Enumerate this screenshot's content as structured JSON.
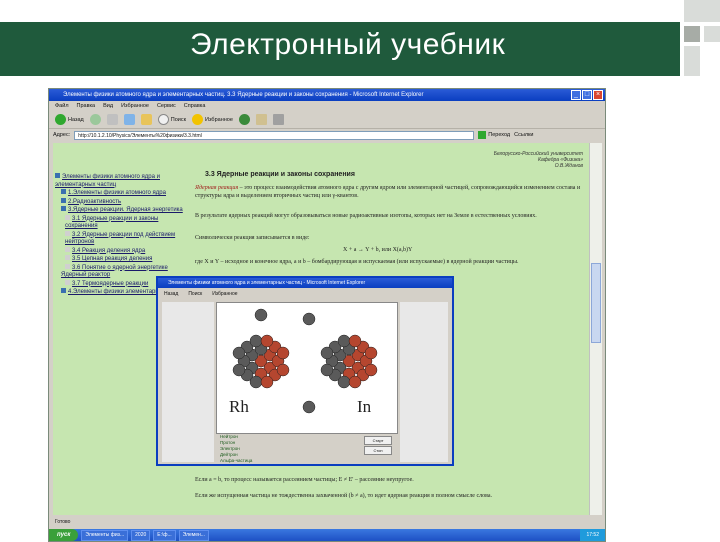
{
  "slide": {
    "title": "Электронный учебник",
    "colors": {
      "title_bg": "#1f5a3c",
      "title_text": "#ffffff",
      "corner_blocks": "#d9dcd9"
    }
  },
  "browser": {
    "window_title": "Элементы физики атомного ядра и элементарных частиц. 3.3 Ядерные реакции и законы сохранения - Microsoft Internet Explorer",
    "menu": [
      "Файл",
      "Правка",
      "Вид",
      "Избранное",
      "Сервис",
      "Справка"
    ],
    "toolbar": {
      "back": "Назад",
      "search": "Поиск",
      "favorites": "Избранное"
    },
    "address_label": "Адрес:",
    "address_value": "http://10.1.2.10/Physics/Элементы%20физики/3.3.html",
    "go_label": "Переход",
    "links_label": "Ссылки",
    "status_text": "Готово",
    "taskbar": {
      "start": "пуск",
      "items": [
        "Элементы физ...",
        "2020",
        "Е:\\ф...",
        "Элемен..."
      ],
      "clock": "17:52"
    }
  },
  "page": {
    "university": [
      "Белорусско-Российский университет",
      "Кафедра «Физика»",
      "О.В.Жданов"
    ],
    "section_title": "3.3 Ядерные реакции и законы сохранения",
    "paragraph1_term": "Ядерная реакция",
    "paragraph1": " – это процесс взаимодействия атомного ядра с другим ядром или элементарной частицей, сопровождающийся изменением состава и структуры ядра и выделением вторичных частиц или γ-квантов.",
    "paragraph2": "В результате ядерных реакций могут образовываться новые радиоактивные изотопы, которых нет на Земле в естественных условиях.",
    "paragraph3": "Символически реакция записывается в виде:",
    "formula": "X + a → Y + b, или X(a,b)Y",
    "paragraph4": "где X и Y – исходное и конечное ядра, a и b – бомбардирующая и испускаемая (или испускаемые) в ядерной реакции частицы.",
    "paragraph5": "Если a = b, то процесс называется рассеянием частицы; Е ≠ E' – рассеяние неупругое.",
    "paragraph6": "Если же испущенная частица не тождественна захваченной (b ≠ a), то идет ядерная реакция в полном смысле слова."
  },
  "nav": [
    "Элементы физики атомного ядра и элементарных частиц",
    "1.Элементы физики атомного ядра",
    "2.Радиоактивность",
    "3.Ядерные реакции. Ядерная энергетика",
    "3.1 Ядерные реакции и законы сохранения",
    "3.2 Ядерные реакции под действием нейтронов",
    "3.4 Реакция деления ядра",
    "3.5 Цепная реакция деления",
    "3.6 Понятие о ядерной энергетике",
    "Ядерный реактор",
    "3.7 Термоядерные реакции",
    "4.Элементы физики элементарных частиц"
  ],
  "popup": {
    "window_title": "Элементы физики атомного ядра и элементарных частиц - Microsoft Internet Explorer",
    "toolbar": {
      "back": "Назад",
      "search": "Поиск",
      "favorites": "Избранное"
    },
    "nucleus_left": "Rh",
    "nucleus_right": "In",
    "legend": [
      "Нейтрон",
      "Протон",
      "Электрон",
      "Дейтрон",
      "Альфа-частица"
    ],
    "buttons": [
      "Старт",
      "Стоп"
    ],
    "colors": {
      "proton": "#b5462f",
      "neutron": "#5a5a5a"
    }
  }
}
